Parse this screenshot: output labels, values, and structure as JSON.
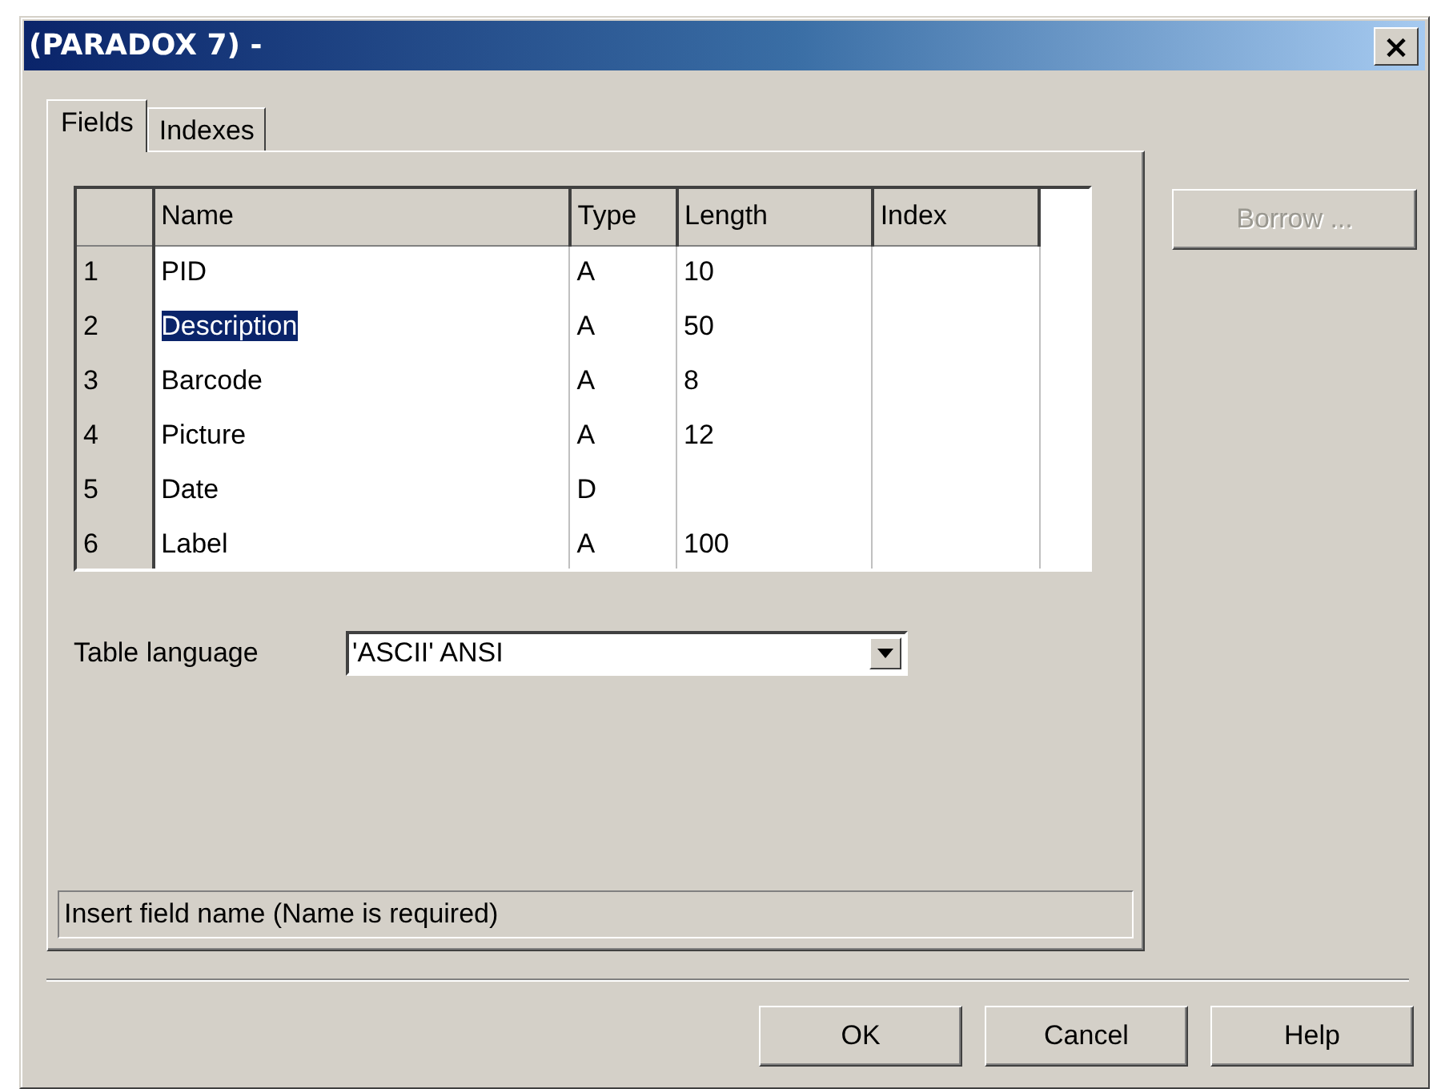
{
  "window": {
    "title": "(PARADOX 7) -",
    "close_label": "×"
  },
  "tabs": [
    {
      "label": "Fields",
      "selected": true
    },
    {
      "label": "Indexes",
      "selected": false
    }
  ],
  "table": {
    "columns": [
      "Name",
      "Type",
      "Length",
      "Index"
    ],
    "rows": [
      {
        "number": "1",
        "cells": [
          "PID",
          "A",
          "10",
          ""
        ],
        "selected": false
      },
      {
        "number": "2",
        "cells": [
          "Description",
          "A",
          "50",
          ""
        ],
        "selected": true
      },
      {
        "number": "3",
        "cells": [
          "Barcode",
          "A",
          "8",
          ""
        ],
        "selected": false
      },
      {
        "number": "4",
        "cells": [
          "Picture",
          "A",
          "12",
          ""
        ],
        "selected": false
      },
      {
        "number": "5",
        "cells": [
          "Date",
          "D",
          "",
          ""
        ],
        "selected": false
      },
      {
        "number": "6",
        "cells": [
          "Label",
          "A",
          "100",
          ""
        ],
        "selected": false
      }
    ]
  },
  "table_language": {
    "label": "Table language",
    "value": "'ASCII' ANSI"
  },
  "status_bar": "Insert field name (Name is required)",
  "side_buttons": [
    {
      "label": "Borrow ...",
      "disabled": true
    }
  ],
  "buttons": [
    {
      "label": "OK",
      "disabled": false
    },
    {
      "label": "Cancel",
      "disabled": false
    },
    {
      "label": "Help",
      "disabled": false
    }
  ]
}
